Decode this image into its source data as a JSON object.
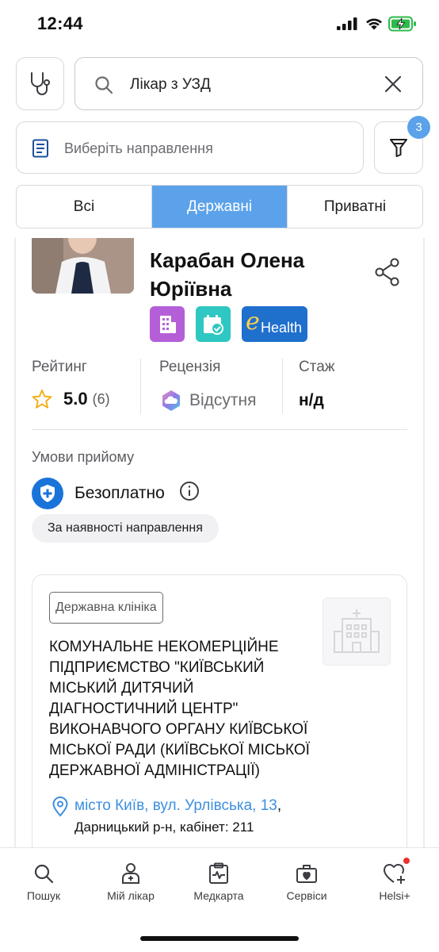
{
  "status_bar": {
    "time": "12:44"
  },
  "search": {
    "value": "Лікар з УЗД",
    "icon": "search-icon"
  },
  "direction": {
    "placeholder": "Виберіть направлення"
  },
  "filter": {
    "badge_count": "3"
  },
  "tabs": [
    {
      "label": "Всі",
      "active": false
    },
    {
      "label": "Державні",
      "active": true
    },
    {
      "label": "Приватні",
      "active": false
    }
  ],
  "doctor": {
    "name": "Карабан Олена Юріївна",
    "badges": [
      "clinic-badge-icon",
      "calendar-check-icon",
      "ehealth-logo"
    ],
    "ehealth_text": "Health",
    "ehealth_letter": "e"
  },
  "stats": {
    "rating_label": "Рейтинг",
    "rating_value": "5.0",
    "rating_count": "(6)",
    "review_label": "Рецензія",
    "review_value": "Відсутня",
    "experience_label": "Стаж",
    "experience_value": "н/д"
  },
  "conditions": {
    "title": "Умови прийому",
    "payment": "Безоплатно",
    "chip": "За наявності направлення"
  },
  "clinic": {
    "type_tag": "Державна клініка",
    "name": "КОМУНАЛЬНЕ НЕКОМЕРЦІЙНЕ ПІДПРИЄМСТВО \"КИЇВСЬКИЙ МІСЬКИЙ ДИТЯЧИЙ ДІАГНОСТИЧНИЙ ЦЕНТР\" ВИКОНАВЧОГО ОРГАНУ КИЇВСЬКОЇ МІСЬКОЇ РАДИ  (КИЇВСЬКОЇ МІСЬКОЇ ДЕРЖАВНОЇ АДМІНІСТРАЦІЇ)",
    "address_link": "місто Київ, вул. Урлівська, 13",
    "address_comma": ",",
    "address_detail": "Дарницький р-н, кабінет: 211"
  },
  "bottom_nav": [
    {
      "label": "Пошук",
      "icon": "search-icon"
    },
    {
      "label": "Мій лікар",
      "icon": "doctor-icon"
    },
    {
      "label": "Медкарта",
      "icon": "medical-card-icon"
    },
    {
      "label": "Сервіси",
      "icon": "medkit-icon"
    },
    {
      "label": "Helsi+",
      "icon": "heart-plus-icon"
    }
  ],
  "colors": {
    "accent": "#5ba2ea",
    "link": "#3d8fe0",
    "badge_purple": "#b45fd8",
    "badge_teal": "#2ec7c2",
    "ehealth_blue": "#1f6fcc",
    "notification": "#e8332f"
  }
}
